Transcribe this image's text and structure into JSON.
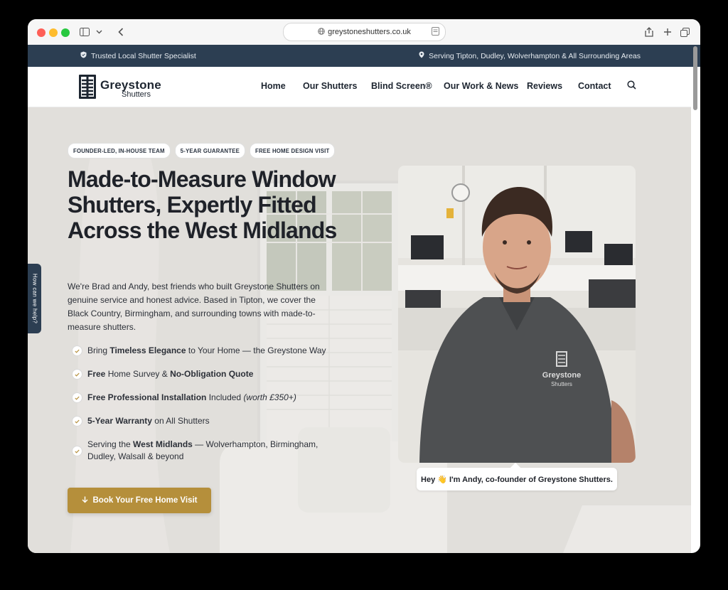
{
  "browser": {
    "url": "greystoneshutters.co.uk"
  },
  "topbar": {
    "left_text": "Trusted Local Shutter Specialist",
    "right_text": "Serving Tipton, Dudley, Wolverhampton & All Surrounding Areas"
  },
  "logo": {
    "name": "Greystone",
    "sub": "Shutters"
  },
  "nav": {
    "items": [
      "Home",
      "Our Shutters",
      "Blind Screen®",
      "Our Work & News",
      "Reviews",
      "Contact"
    ]
  },
  "hero": {
    "badges": [
      "FOUNDER-LED, IN-HOUSE TEAM",
      "5-YEAR GUARANTEE",
      "FREE HOME DESIGN VISIT"
    ],
    "headline": "Made-to-Measure Window Shutters, Expertly Fitted Across the West Midlands",
    "intro": "We're Brad and Andy, best friends who built Greystone Shutters on genuine service and honest advice. Based in Tipton, we cover the Black Country, Birmingham, and surrounding towns with made-to-measure shutters.",
    "checks": [
      {
        "pre": "Bring ",
        "bold": "Timeless Elegance",
        "post": " to Your Home — the Greystone Way"
      },
      {
        "pre": "",
        "bold": "Free",
        "post": " Home Survey & ",
        "bold2": "No-Obligation Quote"
      },
      {
        "pre": "",
        "bold": "Free Professional Installation",
        "post": " Included ",
        "italic": "(worth £350+)"
      },
      {
        "pre": "",
        "bold": "5-Year Warranty",
        "post": " on All Shutters"
      },
      {
        "pre": "Serving the ",
        "bold": "West Midlands",
        "post": " — Wolverhampton, Birmingham, Dudley, Walsall & beyond"
      }
    ],
    "cta": "Book Your Free Home Visit",
    "caption": "Hey 👋 I'm Andy, co-founder of Greystone Shutters.",
    "shirt_logo_name": "Greystone",
    "shirt_logo_sub": "Shutters"
  },
  "help_tab": "How can we help?",
  "colors": {
    "topbar": "#2c3e52",
    "cta": "#b58f3b",
    "text": "#1f2229"
  }
}
